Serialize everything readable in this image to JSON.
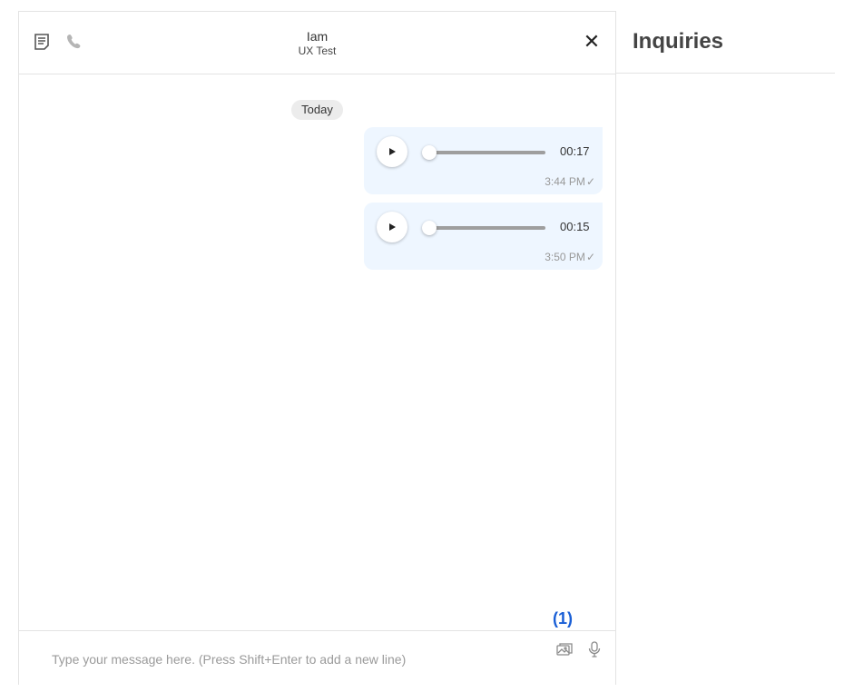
{
  "header": {
    "contact_name": "Iam",
    "contact_subtitle": "UX Test",
    "close_label": "✕",
    "icons": [
      "notes-icon",
      "phone-icon",
      "close-icon"
    ]
  },
  "messages": {
    "date_divider": "Today",
    "items": [
      {
        "type": "voice",
        "duration": "00:17",
        "time": "3:44 PM",
        "status": "✓",
        "progress": 0
      },
      {
        "type": "voice",
        "duration": "00:15",
        "time": "3:50 PM",
        "status": "✓",
        "progress": 0
      }
    ]
  },
  "annotation": {
    "label": "(1)",
    "color": "#1a5fd6"
  },
  "composer": {
    "placeholder": "Type your message here. (Press Shift+Enter to add a new line)",
    "value": "",
    "icons": [
      "image-upload-icon",
      "microphone-icon"
    ]
  },
  "side_panel": {
    "title": "Inquiries"
  },
  "colors": {
    "bubble": "#eef6ff",
    "divider": "#e3e3e3",
    "accent": "#1a5fd6"
  }
}
